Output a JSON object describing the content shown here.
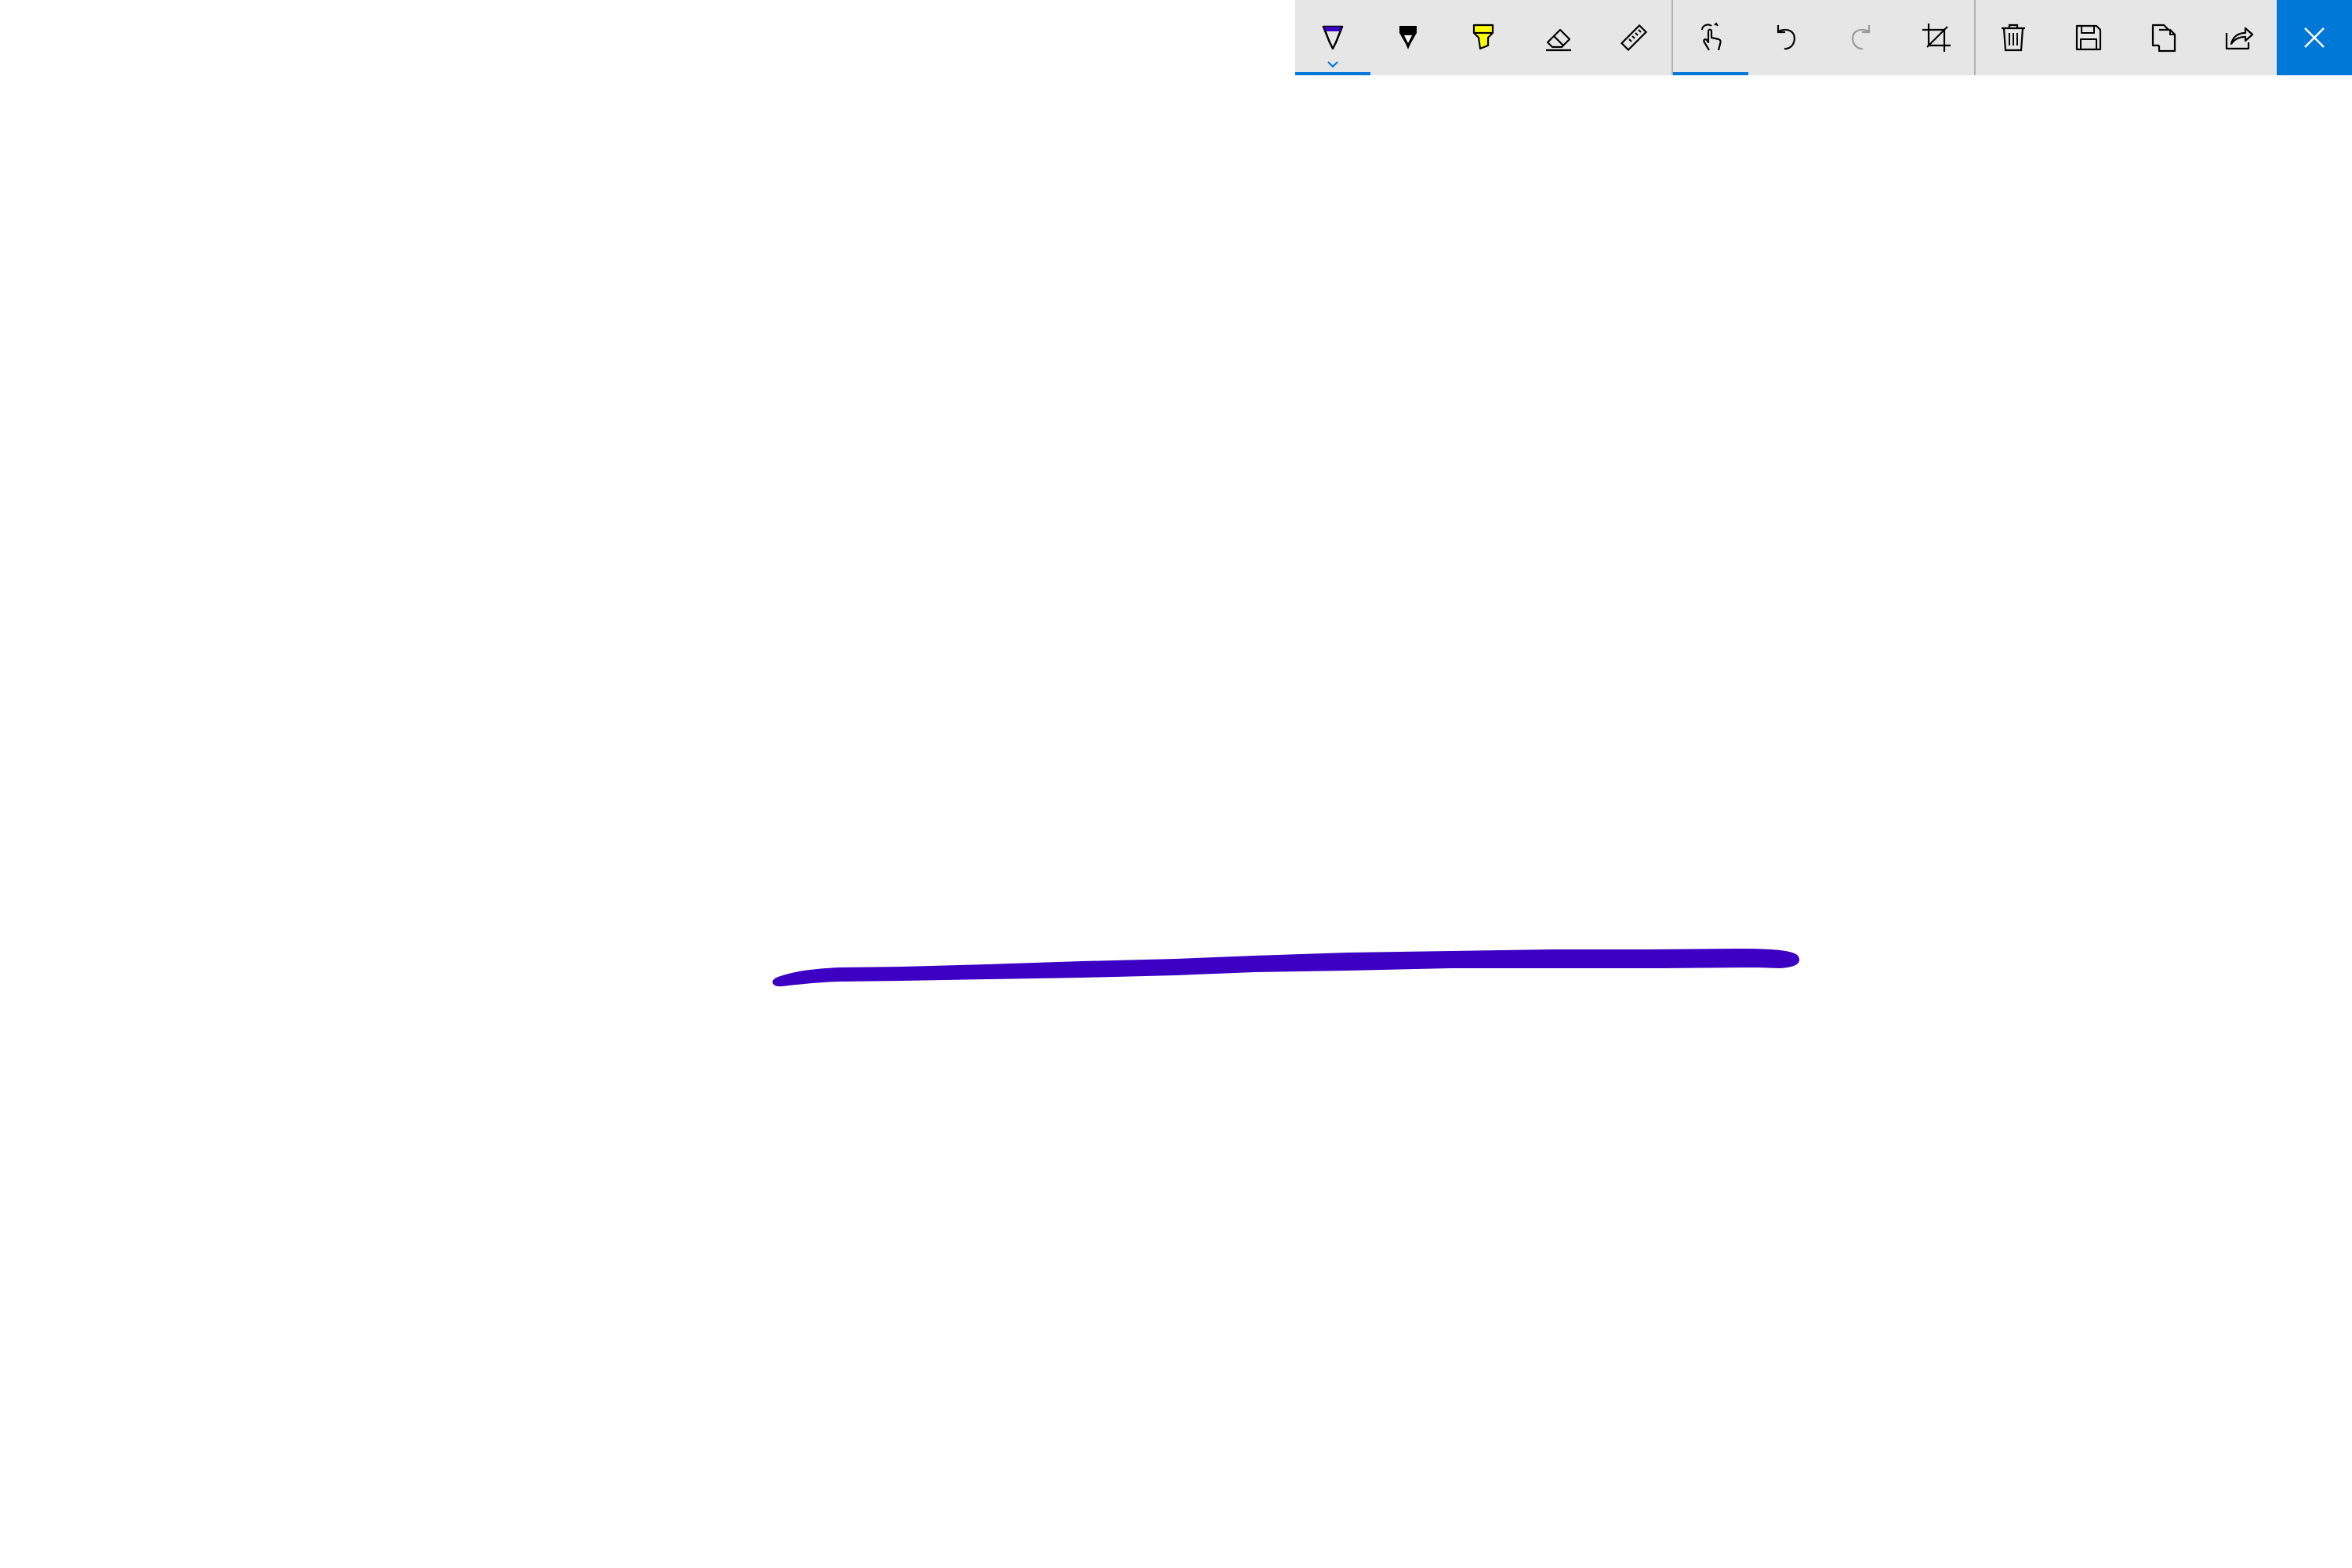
{
  "app": {
    "toolbar": {
      "background": "#e6e6e6",
      "accent": "#0078d7",
      "tools": [
        {
          "name": "ballpoint-pen",
          "icon": "ballpoint-pen-icon",
          "active": true,
          "ink_color": "#3c00c2",
          "has_dropdown": true
        },
        {
          "name": "pencil",
          "icon": "pencil-icon",
          "active": false,
          "ink_color": "#000000"
        },
        {
          "name": "highlighter",
          "icon": "highlighter-icon",
          "active": false,
          "ink_color": "#ffff00"
        },
        {
          "name": "eraser",
          "icon": "eraser-icon",
          "active": false
        },
        {
          "name": "ruler",
          "icon": "ruler-icon",
          "active": false
        }
      ],
      "actions": [
        {
          "name": "touch-writing",
          "icon": "touch-writing-icon",
          "active": true
        },
        {
          "name": "undo",
          "icon": "undo-icon",
          "enabled": true
        },
        {
          "name": "redo",
          "icon": "redo-icon",
          "enabled": false
        },
        {
          "name": "crop",
          "icon": "crop-icon",
          "enabled": true
        }
      ],
      "file_actions": [
        {
          "name": "delete",
          "icon": "trash-icon"
        },
        {
          "name": "save",
          "icon": "save-icon"
        },
        {
          "name": "copy",
          "icon": "copy-icon"
        },
        {
          "name": "share",
          "icon": "share-icon"
        }
      ],
      "close": {
        "icon": "close-icon",
        "background": "#0078d7"
      }
    },
    "canvas": {
      "background": "#ffffff",
      "strokes": [
        {
          "tool": "ballpoint-pen",
          "color": "#3c00c2"
        }
      ]
    }
  }
}
